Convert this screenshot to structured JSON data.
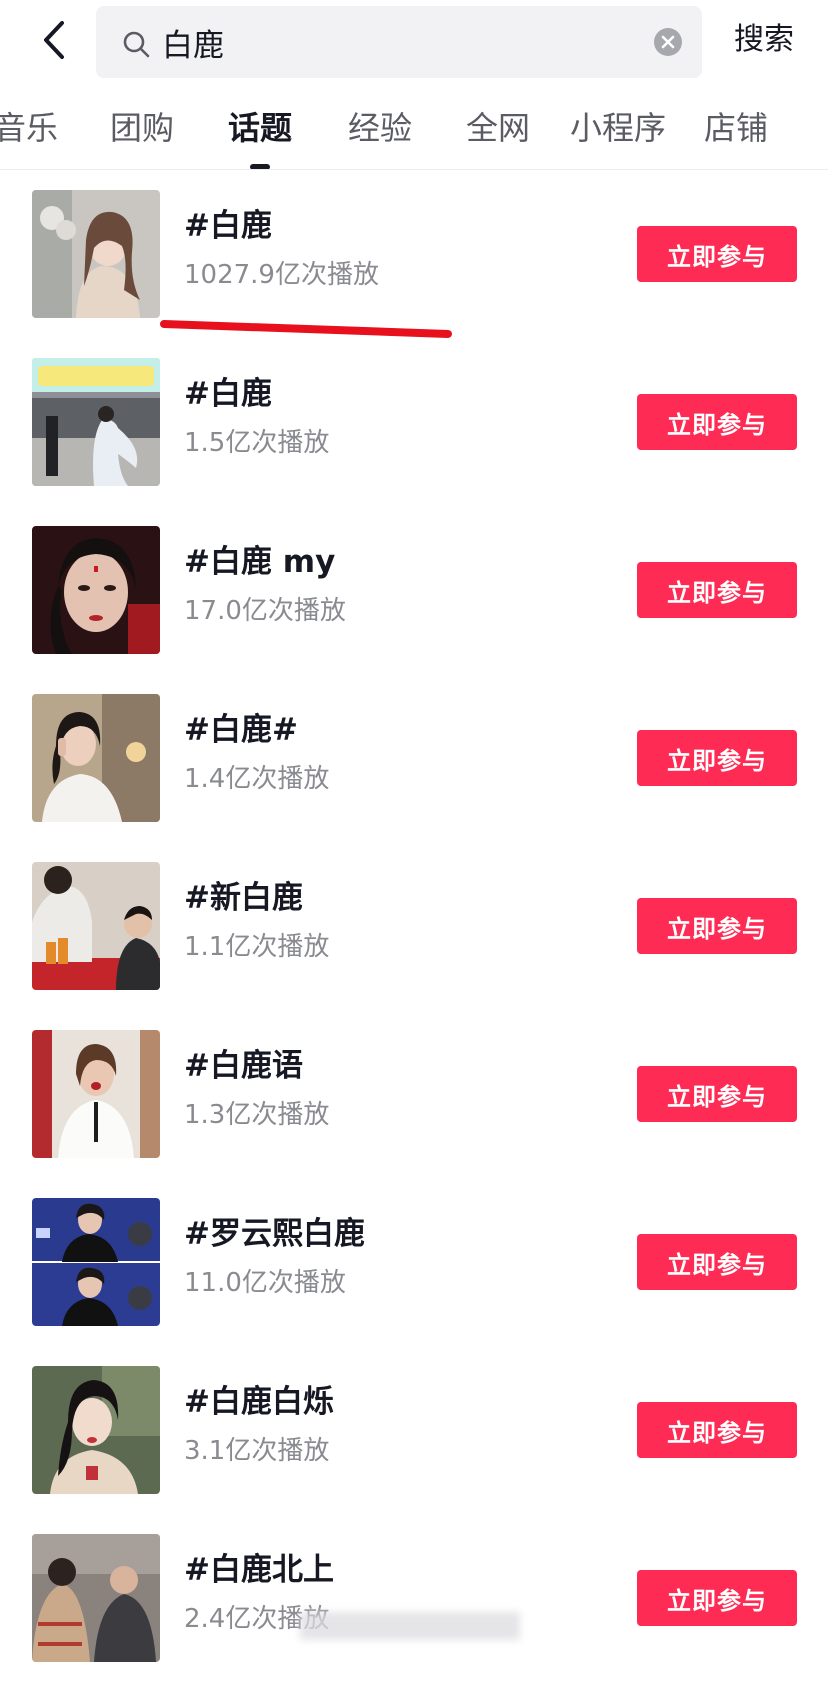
{
  "header": {
    "search_value": "白鹿",
    "search_button": "搜索"
  },
  "tabs": [
    "音乐",
    "团购",
    "话题",
    "经验",
    "全网",
    "小程序",
    "店铺"
  ],
  "active_tab": "话题",
  "join_label": "立即参与",
  "colors": {
    "accent": "#fe2c55",
    "annotation": "#e8101d"
  },
  "topics": [
    {
      "title": "#白鹿",
      "plays": "1027.9亿次播放"
    },
    {
      "title": "#白鹿",
      "plays": "1.5亿次播放"
    },
    {
      "title": "#白鹿 my",
      "plays": "17.0亿次播放"
    },
    {
      "title": "#白鹿#",
      "plays": "1.4亿次播放"
    },
    {
      "title": "#新白鹿",
      "plays": "1.1亿次播放"
    },
    {
      "title": "#白鹿语",
      "plays": "1.3亿次播放"
    },
    {
      "title": "#罗云熙白鹿",
      "plays": "11.0亿次播放"
    },
    {
      "title": "#白鹿白烁",
      "plays": "3.1亿次播放"
    },
    {
      "title": "#白鹿北上",
      "plays": "2.4亿次播放"
    }
  ],
  "thumbnails": [
    "photo",
    "photo",
    "photo",
    "photo",
    "photo",
    "photo",
    "photo",
    "photo",
    "photo"
  ]
}
